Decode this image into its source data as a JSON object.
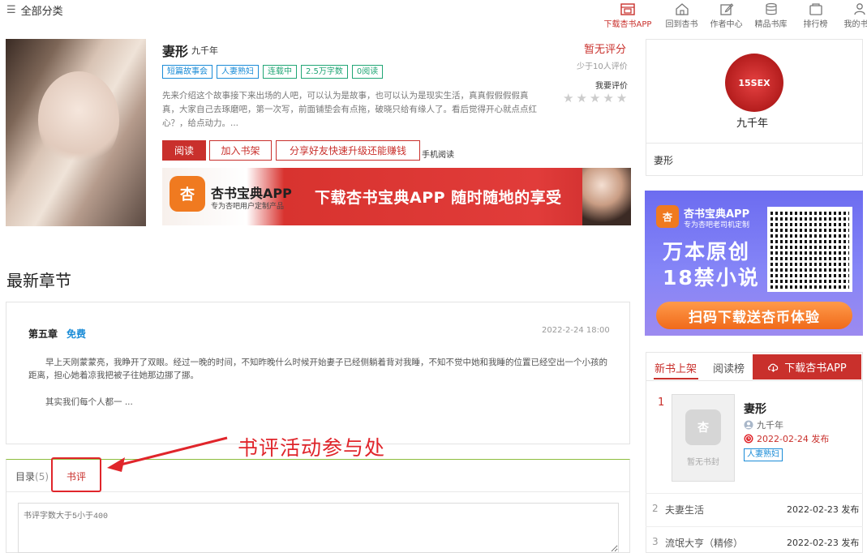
{
  "topbar": {
    "all_categories": "全部分类",
    "nav": [
      {
        "label": "下载杏书APP",
        "icon": "download-app-icon",
        "active": true
      },
      {
        "label": "回到杏书",
        "icon": "home-icon",
        "active": false
      },
      {
        "label": "作者中心",
        "icon": "edit-icon",
        "active": false
      },
      {
        "label": "精品书库",
        "icon": "database-icon",
        "active": false
      },
      {
        "label": "排行榜",
        "icon": "ranking-icon",
        "active": false
      },
      {
        "label": "我的书架",
        "icon": "user-icon",
        "active": false
      }
    ]
  },
  "book": {
    "title": "妻形",
    "author": "九千年",
    "tags": [
      {
        "label": "短篇故事会",
        "color": "blue"
      },
      {
        "label": "人妻熟妇",
        "color": "blue"
      },
      {
        "label": "连载中",
        "color": "green"
      },
      {
        "label": "2.5万字数",
        "color": "green"
      },
      {
        "label": "0阅读",
        "color": "green"
      }
    ],
    "description": "先来介绍这个故事接下来出场的人吧，可以认为是故事，也可以认为是现实生活，真真假假假假真真，大家自己去琢磨吧，第一次写，前面铺垫会有点拖，破晓只给有缘人了。看后觉得开心就点点红心？，给点动力。...",
    "read_label": "阅读",
    "add_shelf_label": "加入书架",
    "share_label": "分享好友快速升级还能赚钱",
    "mobile_read_label": "手机阅读"
  },
  "rating": {
    "no_score": "暂无评分",
    "few_ratings": "少于10人评价",
    "rate_me": "我要评价",
    "stars": 5
  },
  "banner1": {
    "app_name": "杏书宝典APP",
    "app_sub": "专为杏吧用户定制产品",
    "slogan": "下载杏书宝典APP 随时随地的享受"
  },
  "author_card": {
    "name": "九千年",
    "avatar_text": "15SEX",
    "book": "妻形"
  },
  "ad2": {
    "app_name": "杏书宝典APP",
    "app_sub": "专为杏吧老司机定制",
    "big1": "万本原创",
    "big2": "18禁小说",
    "cta": "扫码下载送杏币体验"
  },
  "rank_panel": {
    "tab_new": "新书上架",
    "tab_read": "阅读榜",
    "download_label": "下载杏书APP",
    "first": {
      "rank": "1",
      "title": "妻形",
      "author": "九千年",
      "date": "2022-02-24 发布",
      "tag": "人妻熟妇",
      "cover_caption": "暂无书封"
    },
    "rows": [
      {
        "rank": "2",
        "title": "夫妻生活",
        "date": "2022-02-23 发布"
      },
      {
        "rank": "3",
        "title": "流氓大亨（精修）",
        "date": "2022-02-23 发布"
      }
    ]
  },
  "latest": {
    "heading": "最新章节",
    "chapter_title": "第五章",
    "free_label": "免费",
    "time": "2022-2-24 18:00",
    "text1": "早上天刚蒙蒙亮，我睁开了双眼。经过一晚的时间，不知昨晚什么时候开始妻子已经侧躺着背对我睡，不知不觉中她和我睡的位置已经空出一个小孩的距离，担心她着凉我把被子往她那边挪了挪。",
    "text2": "其实我们每个人都一 ..."
  },
  "tabs": {
    "toc_label": "目录",
    "toc_count": "(5)",
    "review_label": "书评",
    "review_placeholder": "书评字数大于5小于400"
  },
  "annotation": {
    "text": "书评活动参与处"
  },
  "colors": {
    "accent": "#c9302c",
    "tag_blue": "#1b8cd7",
    "tag_green": "#21a675",
    "annotation_red": "#e0252b"
  }
}
